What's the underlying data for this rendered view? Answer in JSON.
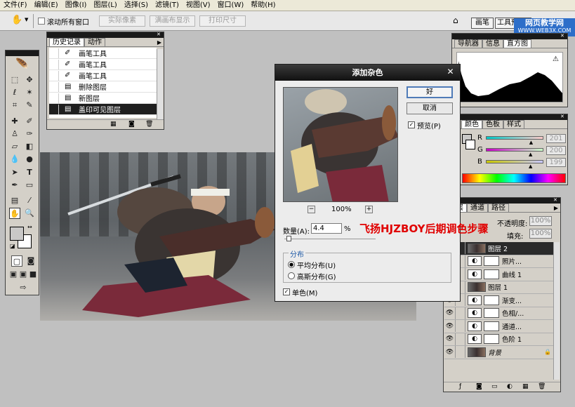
{
  "menu": [
    "文件(F)",
    "编辑(E)",
    "图像(I)",
    "图层(L)",
    "选择(S)",
    "滤镜(T)",
    "视图(V)",
    "窗口(W)",
    "帮助(H)"
  ],
  "options": {
    "scroll_all": "滚动所有窗口",
    "actual_pixels": "实际像素",
    "fit_screen": "满画布显示",
    "print_size": "打印尺寸"
  },
  "dock_tabs": [
    "画笔",
    "工具预设"
  ],
  "watermark": {
    "line1": "网页教学网",
    "line2": "WWW.WEB3X.COM"
  },
  "history_panel": {
    "tabs": [
      "历史记录",
      "动作"
    ],
    "items": [
      {
        "label": "画笔工具",
        "icon": "brush-icon"
      },
      {
        "label": "画笔工具",
        "icon": "brush-icon"
      },
      {
        "label": "画笔工具",
        "icon": "brush-icon"
      },
      {
        "label": "删除图层",
        "icon": "document-icon"
      },
      {
        "label": "新图层",
        "icon": "document-icon"
      },
      {
        "label": "盖印可见图层",
        "icon": "document-icon"
      }
    ]
  },
  "navigator_panel": {
    "tabs": [
      "导航器",
      "信息",
      "直方图"
    ]
  },
  "color_panel": {
    "tabs": [
      "颜色",
      "色板",
      "样式"
    ],
    "rows": [
      {
        "label": "R",
        "value": "201",
        "percent": 0.79
      },
      {
        "label": "G",
        "value": "200",
        "percent": 0.78
      },
      {
        "label": "B",
        "value": "199",
        "percent": 0.78
      }
    ],
    "fg_color": "#c9c8c7"
  },
  "layers_panel": {
    "tabs": [
      "图层",
      "通道",
      "路径"
    ],
    "opacity_label": "不透明度:",
    "opacity_value": "100%",
    "fill_label": "填充:",
    "fill_value": "100%",
    "layers": [
      {
        "name": "图层 2",
        "type": "pixel",
        "selected": true
      },
      {
        "name": "照片...",
        "type": "adjust"
      },
      {
        "name": "曲线 1",
        "type": "adjust"
      },
      {
        "name": "图层 1",
        "type": "pixel"
      },
      {
        "name": "渐变...",
        "type": "adjust"
      },
      {
        "name": "色相/...",
        "type": "adjust"
      },
      {
        "name": "通道...",
        "type": "adjust"
      },
      {
        "name": "色阶 1",
        "type": "adjust"
      },
      {
        "name": "背景",
        "type": "pixel",
        "italic": true
      }
    ]
  },
  "dialog": {
    "title": "添加杂色",
    "ok": "好",
    "cancel": "取消",
    "preview": "预览(P)",
    "zoom": "100%",
    "zoom_minus": "−",
    "zoom_plus": "+",
    "amount_label": "数量(A):",
    "amount_value": "4.4",
    "amount_unit": "%",
    "amount_level": 0.02,
    "distribution_title": "分布",
    "uniform": "平均分布(U)",
    "gaussian": "高斯分布(G)",
    "mono": "单色(M)"
  },
  "annotation": {
    "text": "飞扬HJZBOY后期调色步骤",
    "color": "#e00000"
  }
}
